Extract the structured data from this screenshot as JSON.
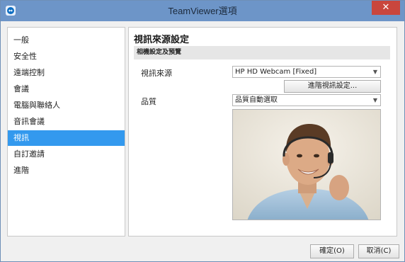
{
  "window": {
    "title": "TeamViewer選項",
    "close_label": "✕",
    "app_icon": "teamviewer-icon"
  },
  "sidebar": {
    "items": [
      {
        "label": "一般"
      },
      {
        "label": "安全性"
      },
      {
        "label": "遠端控制"
      },
      {
        "label": "會議"
      },
      {
        "label": "電腦與聯絡人"
      },
      {
        "label": "音訊會議"
      },
      {
        "label": "視訊",
        "active": true
      },
      {
        "label": "自訂邀請"
      },
      {
        "label": "進階"
      }
    ]
  },
  "content": {
    "title": "視訊來源設定",
    "group_header": "相機設定及預覽",
    "video_source_label": "視訊來源",
    "video_source_value": "HP HD Webcam [Fixed]",
    "advanced_button": "進階視訊設定...",
    "quality_label": "品質",
    "quality_value": "品質自動選取",
    "preview_alt": "webcam-preview"
  },
  "footer": {
    "ok_label": "確定(O)",
    "cancel_label": "取消(C)"
  },
  "colors": {
    "titlebar": "#6d95c8",
    "close": "#c9463d",
    "selection": "#3399ee"
  }
}
